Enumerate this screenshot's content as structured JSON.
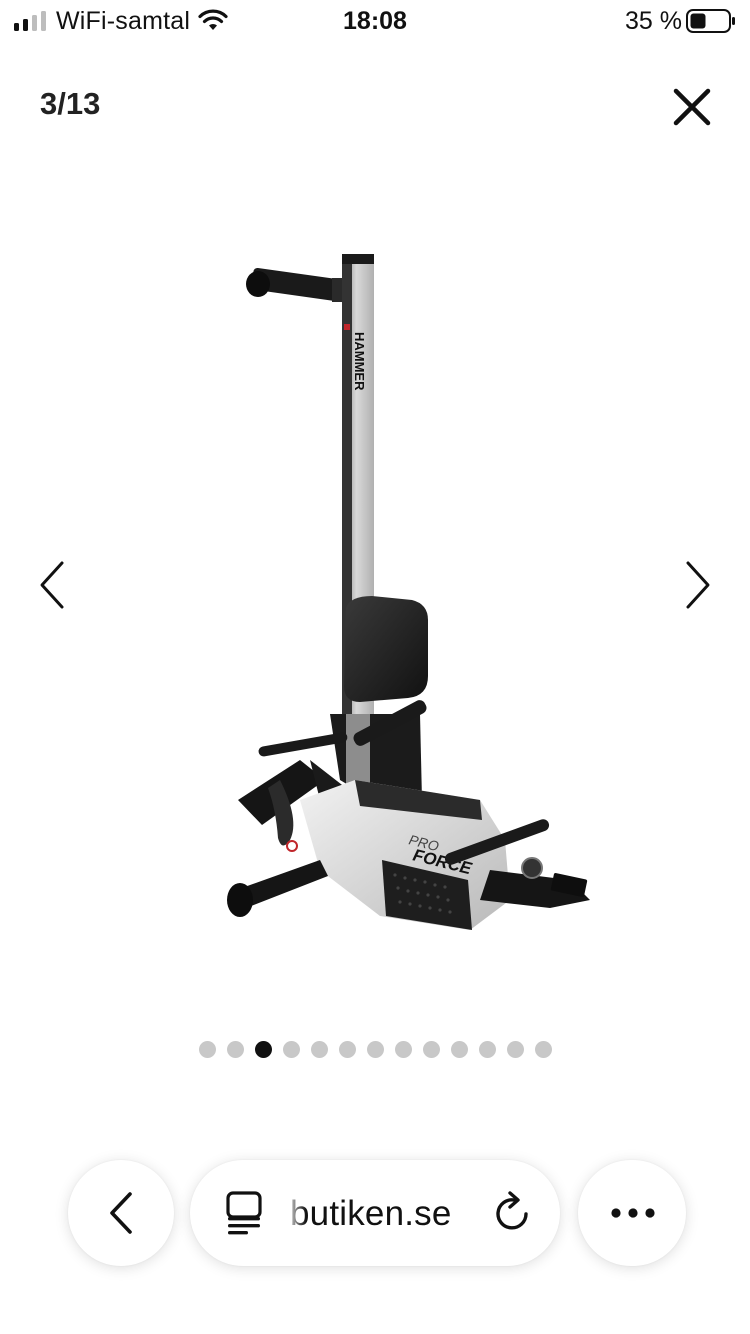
{
  "status_bar": {
    "carrier": "WiFi-samtal",
    "time": "18:08",
    "battery_percent": "35 %",
    "icons": [
      "signal-icon",
      "wifi-icon",
      "battery-icon"
    ]
  },
  "viewer": {
    "counter": "3/13",
    "close_icon": "close-icon",
    "prev_icon": "chevron-left-icon",
    "next_icon": "chevron-right-icon",
    "image_brand": "HAMMER",
    "image_model_line1": "PRO",
    "image_model_line2": "FORCE"
  },
  "pagination": {
    "total": 13,
    "active_index": 2
  },
  "toolbar": {
    "back_icon": "chevron-left-icon",
    "tabs_icon": "tabs-icon",
    "url": "butiken.se",
    "reload_icon": "reload-icon",
    "more_icon": "ellipsis-icon"
  },
  "colors": {
    "dot_inactive": "#c8c8c8",
    "dot_active": "#111111",
    "background": "#ffffff"
  }
}
